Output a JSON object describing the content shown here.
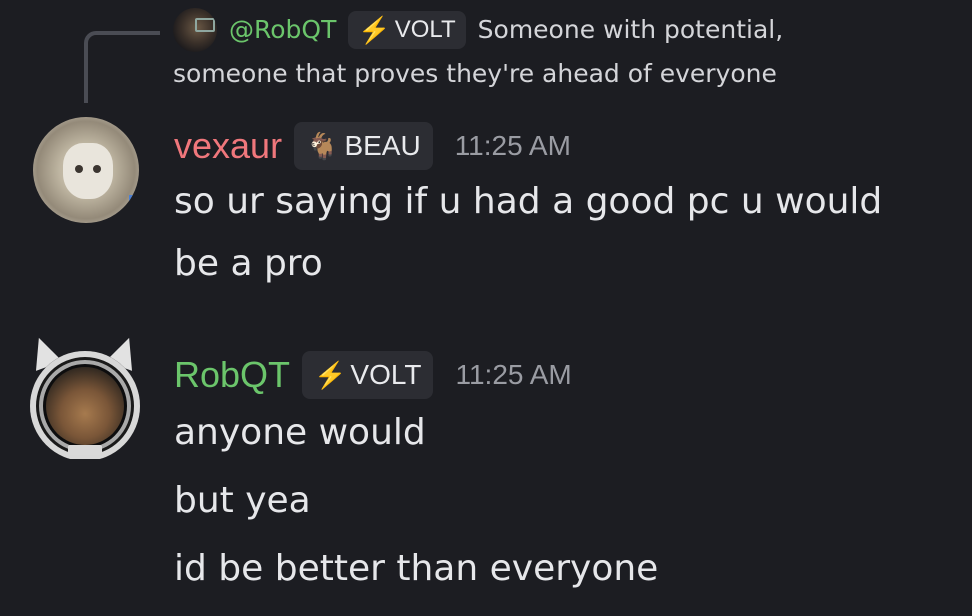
{
  "reply": {
    "author": "@RobQT",
    "tag_label": "VOLT",
    "tag_icon": "lightning-icon",
    "text_line1": "Someone with potential,",
    "text_line2": "someone that proves they're ahead of everyone"
  },
  "messages": [
    {
      "author": "vexaur",
      "author_color": "#f0777c",
      "tag_label": "BEAU",
      "tag_icon": "goat-icon",
      "timestamp": "11:25 AM",
      "lines": [
        "so ur saying if u had a good pc u would",
        "be a pro"
      ]
    },
    {
      "author": "RobQT",
      "author_color": "#6bc56b",
      "tag_label": "VOLT",
      "tag_icon": "lightning-icon",
      "timestamp": "11:25 AM",
      "lines": [
        "anyone would",
        "but yea",
        "id be better than everyone"
      ]
    }
  ],
  "colors": {
    "background": "#1c1d22",
    "tag_background": "#2c2d33",
    "timestamp": "#9a9ca3",
    "lightning": "#8ea0ff"
  }
}
